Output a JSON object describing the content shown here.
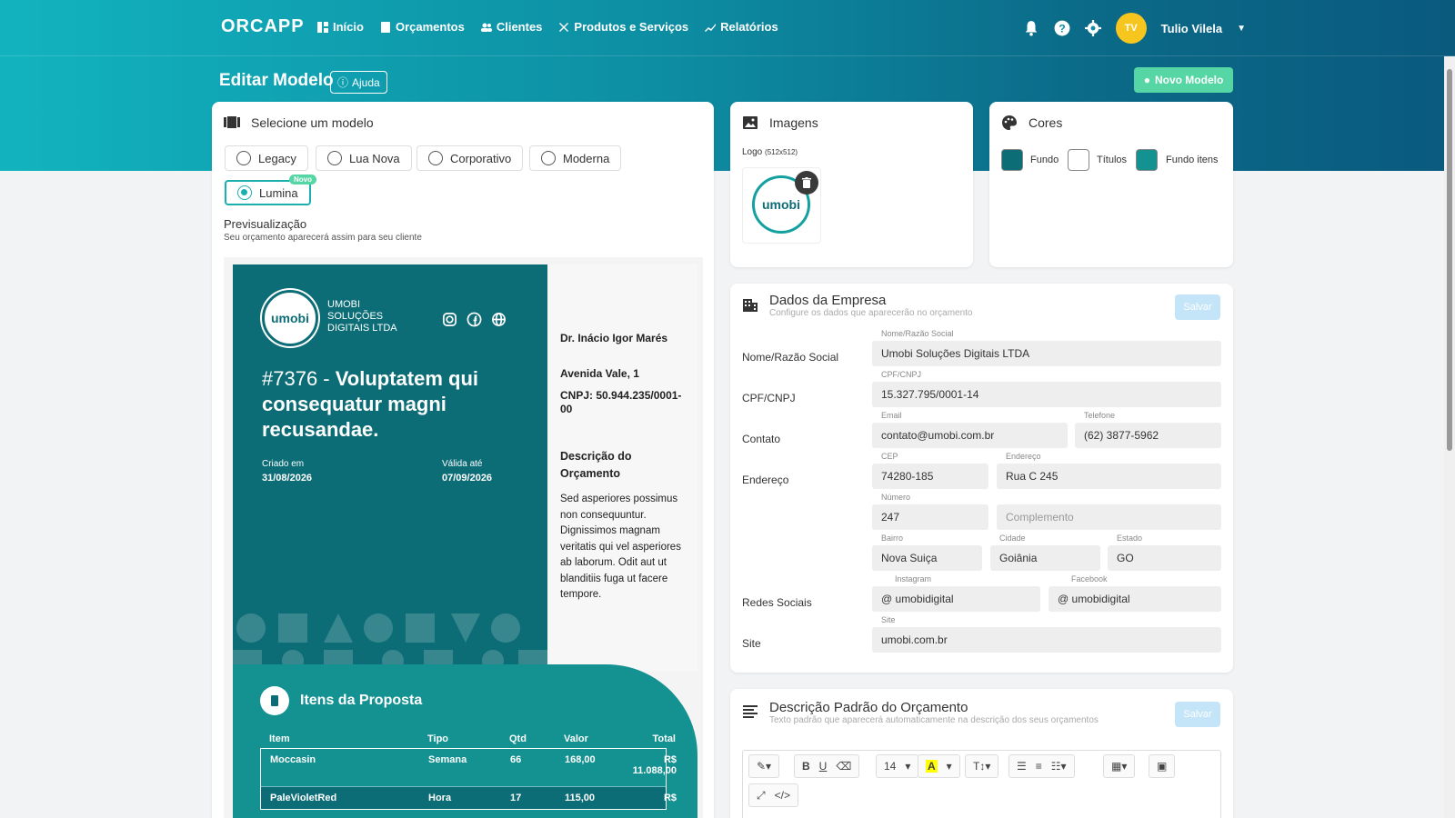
{
  "app": {
    "logo": "ORCAPP",
    "nav": [
      {
        "label": "Início",
        "icon": "dashboard-icon"
      },
      {
        "label": "Orçamentos",
        "icon": "document-icon"
      },
      {
        "label": "Clientes",
        "icon": "users-icon"
      },
      {
        "label": "Produtos e Serviços",
        "icon": "tools-icon"
      },
      {
        "label": "Relatórios",
        "icon": "chart-line-icon"
      }
    ],
    "user": {
      "initials": "TV",
      "name": "Tulio Vilela"
    }
  },
  "page": {
    "title": "Editar Modelo",
    "help_label": "Ajuda",
    "new_model_label": "Novo Modelo"
  },
  "model_select": {
    "title": "Selecione um modelo",
    "options": [
      "Legacy",
      "Lua Nova",
      "Corporativo",
      "Moderna",
      "Lumina"
    ],
    "selected": "Lumina",
    "new_badge": "Novo",
    "preview_title": "Previsualização",
    "preview_subtitle": "Seu orçamento aparecerá assim para seu cliente"
  },
  "preview": {
    "logo_text": "umobi",
    "company_line1": "UMOBI",
    "company_line2": "SOLUÇÕES",
    "company_line3": "DIGITAIS LTDA",
    "number": "#7376 - ",
    "title": "Voluptatem qui consequatur magni recusandae.",
    "created_label": "Criado em",
    "created_date": "31/08/2026",
    "valid_label": "Válida até",
    "valid_date": "07/09/2026",
    "client_name": "Dr. Inácio Igor Marés",
    "client_address": "Avenida Vale, 1",
    "client_cnpj": "CNPJ: 50.944.235/0001-00",
    "desc_title": "Descrição do Orçamento",
    "desc_text": "Sed asperiores possimus non consequuntur. Dignissimos magnam veritatis qui vel asperiores ab laborum. Odit aut ut blanditiis fuga ut facere tempore.",
    "items_title": "Itens da Proposta",
    "columns": [
      "Item",
      "Tipo",
      "Qtd",
      "Valor",
      "Total"
    ],
    "rows": [
      {
        "item": "Moccasin",
        "tipo": "Semana",
        "qtd": "66",
        "valor": "168,00",
        "total": "R$ 11.088,00"
      },
      {
        "item": "PaleVioletRed",
        "tipo": "Hora",
        "qtd": "17",
        "valor": "115,00",
        "total": "R$"
      }
    ]
  },
  "images": {
    "title": "Imagens",
    "logo_label": "Logo",
    "logo_size": "(512x512)",
    "logo_text": "umobi"
  },
  "colors": {
    "title": "Cores",
    "items": [
      {
        "label": "Fundo",
        "color": "#0c6d77"
      },
      {
        "label": "Títulos",
        "color": "#ffffff"
      },
      {
        "label": "Fundo itens",
        "color": "#149191"
      }
    ]
  },
  "company": {
    "title": "Dados da Empresa",
    "subtitle": "Configure os dados que aparecerão no orçamento",
    "save_label": "Salvar",
    "row_labels": {
      "name": "Nome/Razão Social",
      "doc": "CPF/CNPJ",
      "contact": "Contato",
      "address": "Endereço",
      "social": "Redes Sociais",
      "site": "Site"
    },
    "field_labels": {
      "name": "Nome/Razão Social",
      "doc": "CPF/CNPJ",
      "email": "Email",
      "phone": "Telefone",
      "cep": "CEP",
      "street": "Endereço",
      "number": "Número",
      "district": "Bairro",
      "city": "Cidade",
      "state": "Estado",
      "instagram": "Instagram",
      "facebook": "Facebook",
      "site": "Site"
    },
    "values": {
      "name": "Umobi Soluções Digitais LTDA",
      "doc": "15.327.795/0001-14",
      "email": "contato@umobi.com.br",
      "phone": "(62) 3877-5962",
      "cep": "74280-185",
      "street": "Rua C 245",
      "number": "247",
      "complement_placeholder": "Complemento",
      "district": "Nova Suiça",
      "city": "Goiânia",
      "state": "GO",
      "instagram": "@ umobidigital",
      "facebook": "@ umobidigital",
      "site": "umobi.com.br"
    }
  },
  "description": {
    "title": "Descrição Padrão do Orçamento",
    "subtitle": "Texto padrão que aparecerá automaticamente na descrição dos seus orçamentos",
    "save_label": "Salvar",
    "font_size": "14"
  }
}
